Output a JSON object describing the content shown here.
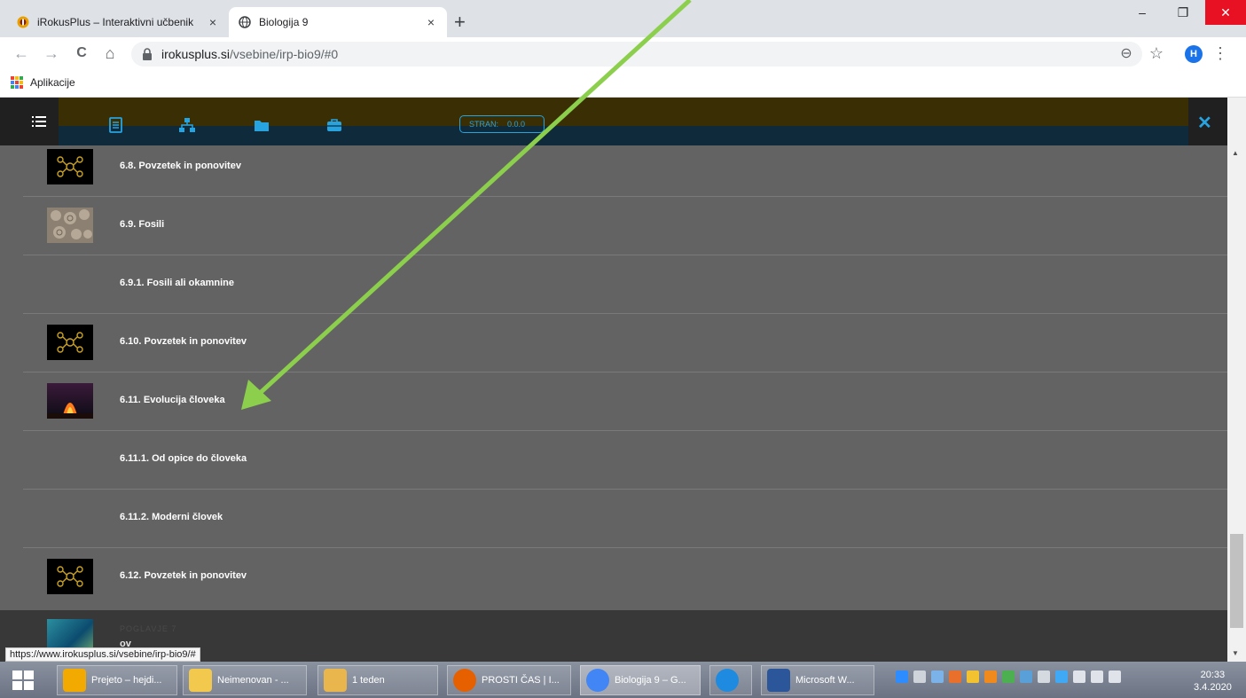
{
  "browser": {
    "tabs": [
      {
        "title": "iRokusPlus – Interaktivni učbenik",
        "close": "×"
      },
      {
        "title": "Biologija 9",
        "close": "×"
      }
    ],
    "new_tab": "+",
    "window_controls": {
      "minimize": "–",
      "restore": "❐",
      "close": "✕"
    },
    "nav": {
      "back": "←",
      "forward": "→",
      "reload": "C",
      "home": "⌂"
    },
    "url": {
      "host": "irokusplus.si",
      "path": "/vsebine/irp-bio9/#0"
    },
    "zoom_icon": "⊖",
    "star_icon": "☆",
    "profile_initial": "H",
    "menu_icon": "⋮",
    "bookmarks": {
      "apps_label": "Aplikacije"
    }
  },
  "app": {
    "header": {
      "page_label": "STRAN:",
      "page_value": "0.0.0",
      "close": "✕"
    },
    "accent": "#27a3e0",
    "items": [
      {
        "label": "6.8. Povzetek in ponovitev",
        "thumb": "mindmap"
      },
      {
        "label": "6.9. Fosili",
        "thumb": "fossil"
      },
      {
        "label": "6.9.1. Fosili ali okamnine",
        "thumb": "none"
      },
      {
        "label": "6.10. Povzetek in ponovitev",
        "thumb": "mindmap"
      },
      {
        "label": "6.11. Evolucija človeka",
        "thumb": "fire"
      },
      {
        "label": "6.11.1. Od opice do človeka",
        "thumb": "none"
      },
      {
        "label": "6.11.2. Moderni človek",
        "thumb": "none"
      },
      {
        "label": "6.12. Povzetek in ponovitev",
        "thumb": "mindmap"
      }
    ],
    "chapter": {
      "kicker": "POGLAVJE 7",
      "title_partial": "ov"
    }
  },
  "status_bar": {
    "url": "https://www.irokusplus.si/vsebine/irp-bio9/#"
  },
  "taskbar": {
    "items": [
      {
        "label": "Prejeto – hejdi...",
        "color": "#f2a900"
      },
      {
        "label": "Neimenovan - ...",
        "color": "#f2c94c"
      },
      {
        "label": "1 teden",
        "color": "#e8b64c"
      },
      {
        "label": "PROSTI ČAS | I...",
        "color": "#e66000"
      },
      {
        "label": "Biologija 9 – G...",
        "color": "#4285f4"
      },
      {
        "label": "",
        "color": "#1e8be0"
      },
      {
        "label": "Microsoft W...",
        "color": "#2b579a"
      }
    ],
    "time": "20:33",
    "date": "3.4.2020"
  }
}
